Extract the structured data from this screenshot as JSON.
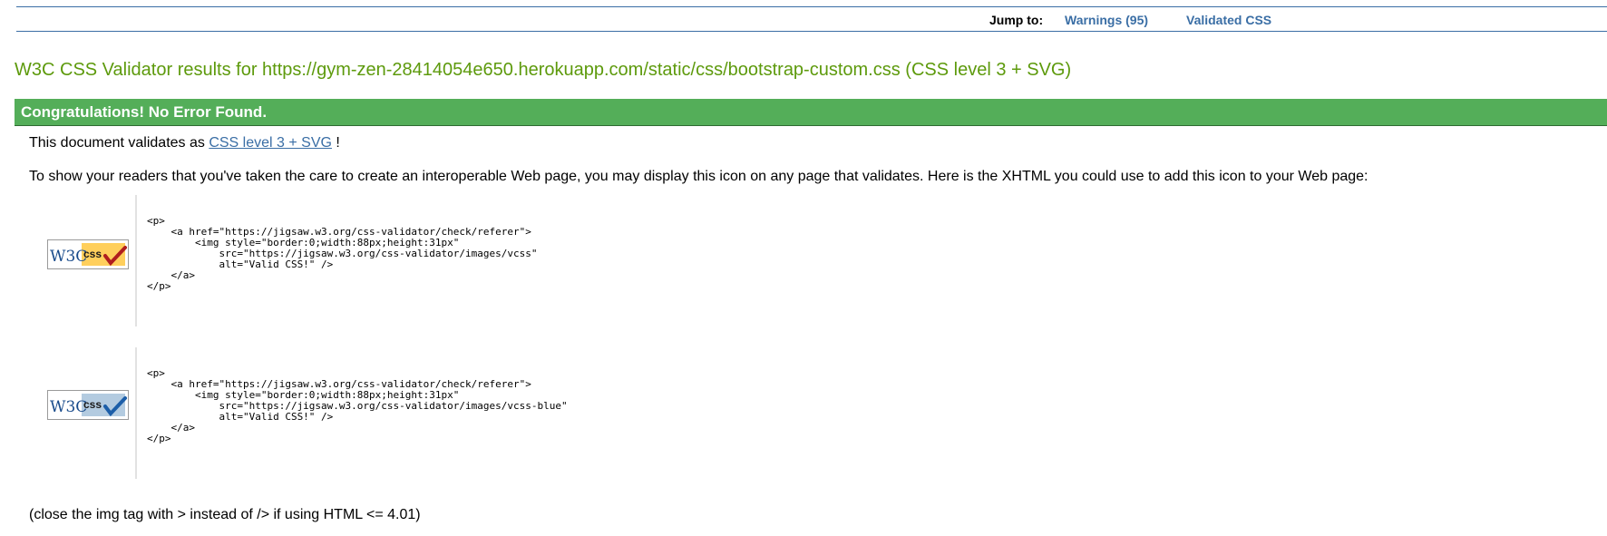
{
  "jump": {
    "label": "Jump to:",
    "links": [
      {
        "label": "Warnings (95)"
      },
      {
        "label": "Validated CSS"
      }
    ]
  },
  "results": {
    "title": "W3C CSS Validator results for https://gym-zen-28414054e650.herokuapp.com/static/css/bootstrap-custom.css (CSS level 3 + SVG)",
    "congrats": "Congratulations! No Error Found.",
    "validates_prefix": "This document validates as ",
    "validates_link": "CSS level 3 + SVG",
    "validates_suffix": " !",
    "icon_intro": "To show your readers that you've taken the care to create an interoperable Web page, you may display this icon on any page that validates. Here is the XHTML you could use to add this icon to your Web page:",
    "close_note": "(close the img tag with > instead of /> if using HTML <= 4.01)"
  },
  "badges": [
    {
      "icon": "w3c-css-valid-badge-gold",
      "w3c_text": "W3C",
      "css_text": "css",
      "accent": "#ffcf5c",
      "check": "#b01e1e",
      "code": "<p>\n    <a href=\"https://jigsaw.w3.org/css-validator/check/referer\">\n        <img style=\"border:0;width:88px;height:31px\"\n            src=\"https://jigsaw.w3.org/css-validator/images/vcss\"\n            alt=\"Valid CSS!\" />\n    </a>\n</p>"
    },
    {
      "icon": "w3c-css-valid-badge-blue",
      "w3c_text": "W3C",
      "css_text": "css",
      "accent": "#b3cbe0",
      "check": "#1c5ea8",
      "code": "<p>\n    <a href=\"https://jigsaw.w3.org/css-validator/check/referer\">\n        <img style=\"border:0;width:88px;height:31px\"\n            src=\"https://jigsaw.w3.org/css-validator/images/vcss-blue\"\n            alt=\"Valid CSS!\" />\n    </a>\n</p>"
    }
  ],
  "colors": {
    "title_green": "#5d9a0c",
    "congrats_bg": "#54ae59",
    "link_blue": "#3a6ea5",
    "w3c_blue": "#1a4c8c"
  }
}
